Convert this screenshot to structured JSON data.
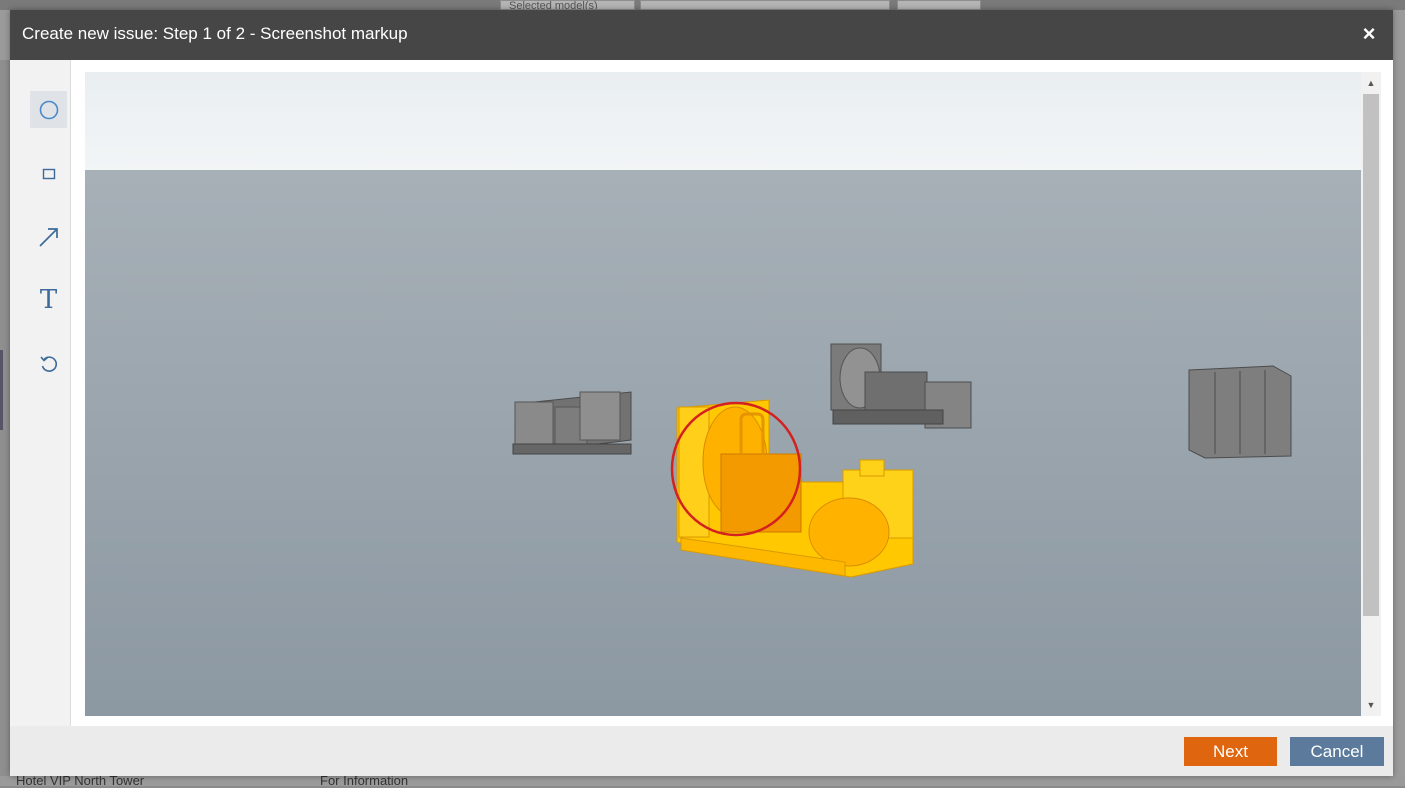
{
  "modal": {
    "title": "Create new issue: Step 1 of 2 - Screenshot markup",
    "close_label": "×"
  },
  "toolbar": {
    "tools": [
      {
        "name": "circle",
        "icon": "circle-icon",
        "active": true
      },
      {
        "name": "rectangle",
        "icon": "rectangle-icon",
        "active": false
      },
      {
        "name": "arrow",
        "icon": "arrow-icon",
        "active": false
      },
      {
        "name": "text",
        "icon": "text-icon",
        "glyph": "T",
        "active": false
      },
      {
        "name": "undo",
        "icon": "undo-icon",
        "active": false
      }
    ]
  },
  "footer": {
    "next_label": "Next",
    "cancel_label": "Cancel"
  },
  "background": {
    "top_field": "Selected model(s)",
    "bottom_left": "Hotel VIP North Tower",
    "bottom_mid": "For Information"
  },
  "colors": {
    "header": "#464646",
    "next_button": "#e0650f",
    "cancel_button": "#5b7a9c",
    "markup_circle": "#d42020",
    "highlight": "#ffb400"
  }
}
